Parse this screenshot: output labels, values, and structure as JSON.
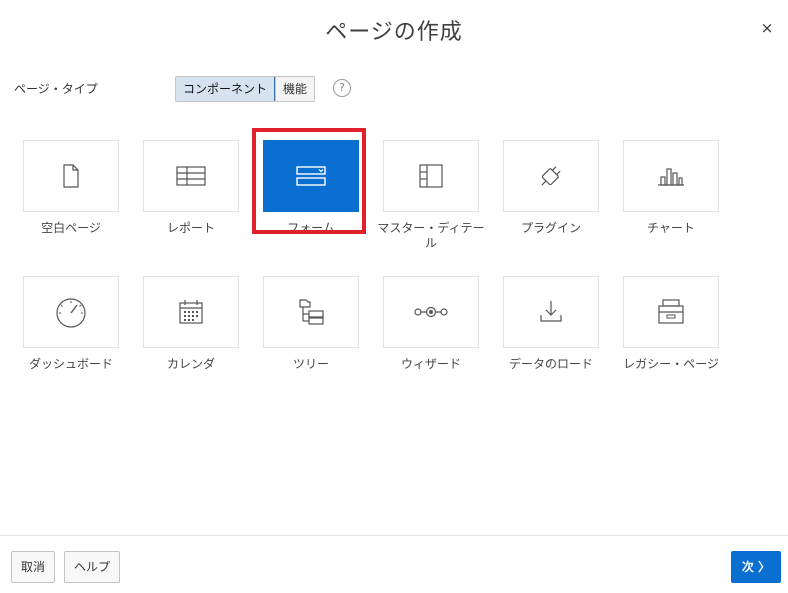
{
  "dialog": {
    "title": "ページの作成",
    "close_glyph": "×"
  },
  "page_type": {
    "label": "ページ・タイプ",
    "options": [
      {
        "label": "コンポーネント",
        "selected": true
      },
      {
        "label": "機能",
        "selected": false
      }
    ],
    "help_glyph": "?"
  },
  "tiles": [
    {
      "label": "空白ページ",
      "icon": "blank-page-icon",
      "selected": false
    },
    {
      "label": "レポート",
      "icon": "report-table-icon",
      "selected": false
    },
    {
      "label": "フォーム",
      "icon": "form-icon",
      "selected": true
    },
    {
      "label": "マスター・ディテール",
      "icon": "master-detail-icon",
      "selected": false
    },
    {
      "label": "プラグイン",
      "icon": "plugin-icon",
      "selected": false
    },
    {
      "label": "チャート",
      "icon": "bar-chart-icon",
      "selected": false
    },
    {
      "label": "ダッシュボード",
      "icon": "dashboard-gauge-icon",
      "selected": false
    },
    {
      "label": "カレンダ",
      "icon": "calendar-icon",
      "selected": false
    },
    {
      "label": "ツリー",
      "icon": "tree-icon",
      "selected": false
    },
    {
      "label": "ウィザード",
      "icon": "wizard-icon",
      "selected": false
    },
    {
      "label": "データのロード",
      "icon": "data-load-icon",
      "selected": false
    },
    {
      "label": "レガシー・ページ",
      "icon": "legacy-page-icon",
      "selected": false
    }
  ],
  "footer": {
    "cancel_label": "取消",
    "help_label": "ヘルプ",
    "next_label": "次 〉"
  },
  "colors": {
    "accent": "#0a6fd0",
    "highlight": "#e0202a"
  }
}
